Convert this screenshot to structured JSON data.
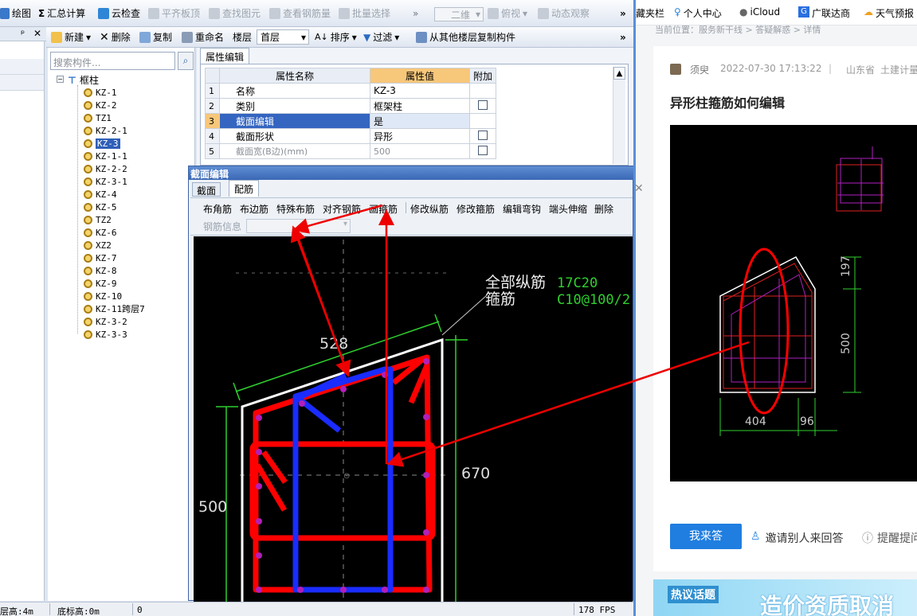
{
  "main_toolbar": {
    "items": [
      "绘图",
      "汇总计算",
      "云检查",
      "平齐板顶",
      "查找图元",
      "查看钢筋量",
      "批量选择",
      "二维",
      "俯视",
      "动态观察"
    ],
    "overflow": "»"
  },
  "nav_panel": {
    "pin": "ᵖ",
    "close": "✕"
  },
  "component_toolbar": {
    "new": "新建",
    "delete": "删除",
    "copy": "复制",
    "rename": "重命名",
    "floor_label": "楼层",
    "floor_value": "首层",
    "sort": "排序",
    "filter": "过滤",
    "copy_from": "从其他楼层复制构件",
    "overflow": "»"
  },
  "search": {
    "placeholder": "搜索构件..."
  },
  "tree": {
    "root": "框柱",
    "items": [
      "KZ-1",
      "KZ-2",
      "TZ1",
      "KZ-2-1",
      "KZ-3",
      "KZ-1-1",
      "KZ-2-2",
      "KZ-3-1",
      "KZ-4",
      "KZ-5",
      "TZ2",
      "KZ-6",
      "XZ2",
      "KZ-7",
      "KZ-8",
      "KZ-9",
      "KZ-10",
      "KZ-11跨层7",
      "KZ-3-2",
      "KZ-3-3"
    ],
    "selected": "KZ-3"
  },
  "properties": {
    "tab": "属性编辑",
    "col_name": "属性名称",
    "col_value": "属性值",
    "col_extra": "附加",
    "rows": [
      {
        "no": "1",
        "name": "名称",
        "value": "KZ-3",
        "check": false
      },
      {
        "no": "2",
        "name": "类别",
        "value": "框架柱",
        "check": true
      },
      {
        "no": "3",
        "name": "截面编辑",
        "value": "是",
        "check": false
      },
      {
        "no": "4",
        "name": "截面形状",
        "value": "异形",
        "check": true
      },
      {
        "no": "5",
        "name": "截面宽(B边)(mm)",
        "value": "500",
        "check": true
      }
    ]
  },
  "section_dialog": {
    "title": "截面编辑",
    "tabs": [
      "截面",
      "配筋"
    ],
    "tools": [
      "布角筋",
      "布边筋",
      "特殊布筋",
      "对齐钢筋",
      "画箍筋",
      "修改纵筋",
      "修改箍筋",
      "编辑弯钩",
      "端头伸缩",
      "删除"
    ],
    "rebar_info": "钢筋信息"
  },
  "cad": {
    "label_all": "全部纵筋",
    "label_stirrup": "箍筋",
    "all_value": "17C20",
    "stirrup_value": "C10@100/2",
    "dim_top": "528",
    "dim_right": "670",
    "dim_left": "500"
  },
  "status_bar": {
    "floor_height": "层高:4m",
    "bottom_elev": "底标高:0m",
    "zero": "0",
    "fps": "178 FPS"
  },
  "browser": {
    "bookmarks": [
      "藏夹栏",
      "个人中心",
      "iCloud",
      "广联达商",
      "天气预报"
    ],
    "breadcrumb": "当前位置：服务新干线 > 答疑解惑 > 详情",
    "author": "须臾",
    "date": "2022-07-30 17:13:22",
    "sep": "|",
    "region": "山东省",
    "category": "土建计量",
    "question": "异形柱箍筋如何编辑",
    "answer_button": "我来答",
    "invite": "邀请别人来回答",
    "remind": "提醒提问",
    "hot_topic": "热议话题",
    "banner_text": "造价资质取消",
    "dialog_close": "✕"
  },
  "drawing": {
    "dim_top": "197",
    "dim_mid": "500",
    "dim_bottom_left": "404",
    "dim_bottom_right": "96"
  }
}
